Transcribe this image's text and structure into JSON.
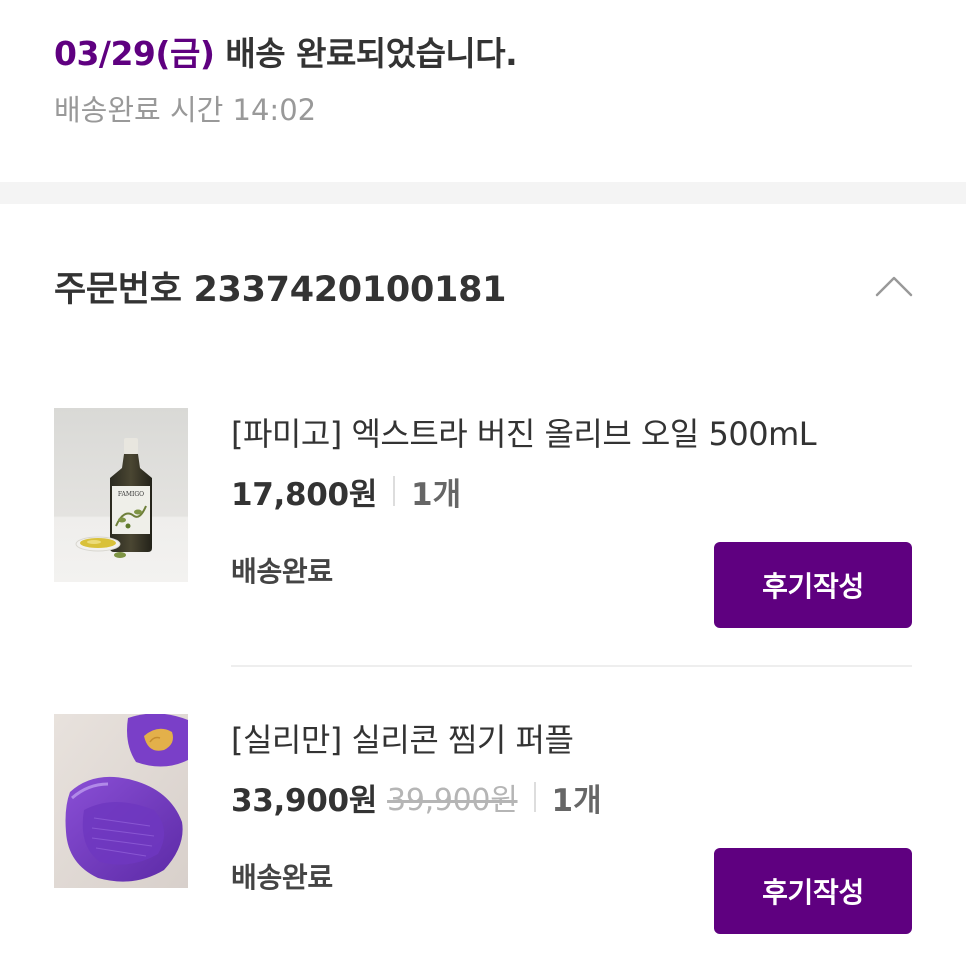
{
  "delivery": {
    "date": "03/29(금)",
    "message": " 배송 완료되었습니다.",
    "time_label": "배송완료 시간 14:02"
  },
  "order": {
    "number_label": "주문번호 2337420100181",
    "toggle_icon": "chevron-up-icon"
  },
  "products": [
    {
      "name": "[파미고] 엑스트라 버진 올리브 오일 500mL",
      "price": "17,800원",
      "original_price": "",
      "quantity": "1개",
      "status": "배송완료",
      "review_button": "후기작성",
      "thumb_icon": "olive-oil-bottle-image"
    },
    {
      "name": "[실리만] 실리콘 찜기 퍼플",
      "price": "33,900원",
      "original_price": "39,900원",
      "quantity": "1개",
      "status": "배송완료",
      "review_button": "후기작성",
      "thumb_icon": "purple-silicone-steamer-image"
    }
  ],
  "colors": {
    "accent": "#5f0080",
    "divider": "#f4f4f4",
    "muted_text": "#999999"
  }
}
